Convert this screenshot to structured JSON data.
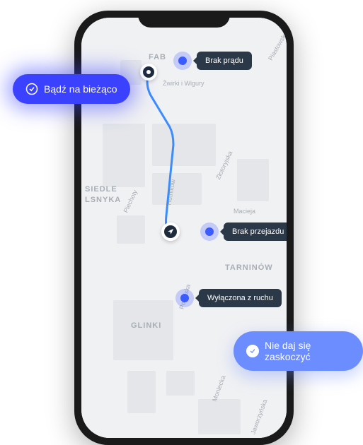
{
  "pills": {
    "stay_updated": "Bądź na bieżąco",
    "no_surprises": "Nie daj się zaskoczyć"
  },
  "map": {
    "neighborhoods": {
      "fab": "FAB",
      "siedle": "SIEDLE",
      "lsnyka": "LSNYKA",
      "tarninow": "TARNINÓW",
      "glinki": "GLINKI"
    },
    "streets": {
      "zwirki": "Żwirki i Wigury",
      "piastowska": "Piastowska",
      "zlotoryjska": "Złotoryjska",
      "piechoty": "Piechoty",
      "hutnikow": "Hutników",
      "macieja": "Macieja",
      "poselska": "Poselska",
      "monlecka": "Monlecka",
      "jaworzynka": "Jaworzyńska"
    },
    "tooltips": {
      "power_outage": "Brak prądu",
      "no_passage": "Brak przejazdu",
      "closed_traffic": "Wyłączona z ruchu"
    }
  }
}
